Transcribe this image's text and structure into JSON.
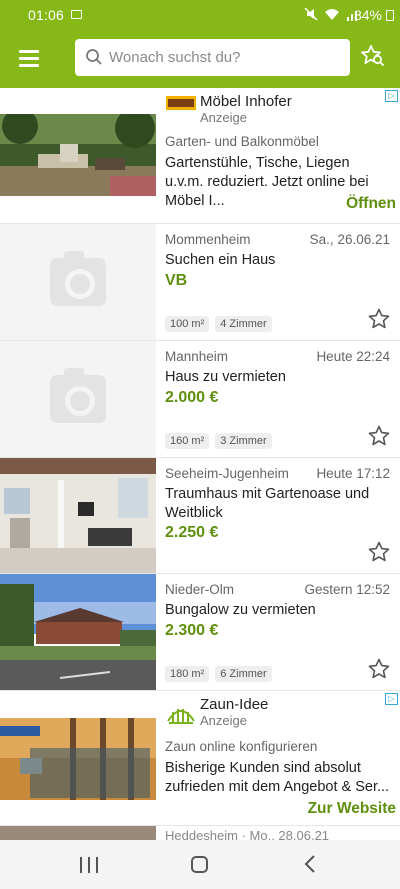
{
  "statusbar": {
    "time": "01:06",
    "battery": "84%"
  },
  "appbar": {
    "search_placeholder": "Wonach suchst du?"
  },
  "ad1": {
    "brand": "Möbel Inhofer",
    "label": "Anzeige",
    "category": "Garten- und Balkonmöbel",
    "description": "Gartenstühle, Tische, Liegen u.v.m. reduziert. Jetzt online bei Möbel I...",
    "cta": "Öffnen"
  },
  "listings": [
    {
      "location": "Mommenheim",
      "date": "Sa., 26.06.21",
      "title": "Suchen ein Haus",
      "price": "VB",
      "tags": [
        "100 m²",
        "4 Zimmer"
      ]
    },
    {
      "location": "Mannheim",
      "date": "Heute 22:24",
      "title": "Haus zu vermieten",
      "price": "2.000 €",
      "tags": [
        "160 m²",
        "3 Zimmer"
      ]
    },
    {
      "location": "Seeheim-Jugenheim",
      "date": "Heute 17:12",
      "title": "Traumhaus mit Gartenoase und Weitblick",
      "price": "2.250 €",
      "tags": []
    },
    {
      "location": "Nieder-Olm",
      "date": "Gestern 12:52",
      "title": "Bungalow zu vermieten",
      "price": "2.300 €",
      "tags": [
        "180 m²",
        "6 Zimmer"
      ]
    }
  ],
  "ad2": {
    "brand": "Zaun-Idee",
    "label": "Anzeige",
    "category": "Zaun online konfigurieren",
    "description": "Bisherige Kunden sind absolut zufrieden mit dem Angebot & Ser...",
    "cta": "Zur Website"
  },
  "peek_text": "Heddesheim · Mo., 28.06.21",
  "colors": {
    "brand_green": "#86b817",
    "price_green": "#5f8f0c"
  },
  "icons": [
    "menu-icon",
    "search-icon",
    "saved-search-icon",
    "star-icon",
    "camera-placeholder-icon",
    "adchoices-icon"
  ]
}
